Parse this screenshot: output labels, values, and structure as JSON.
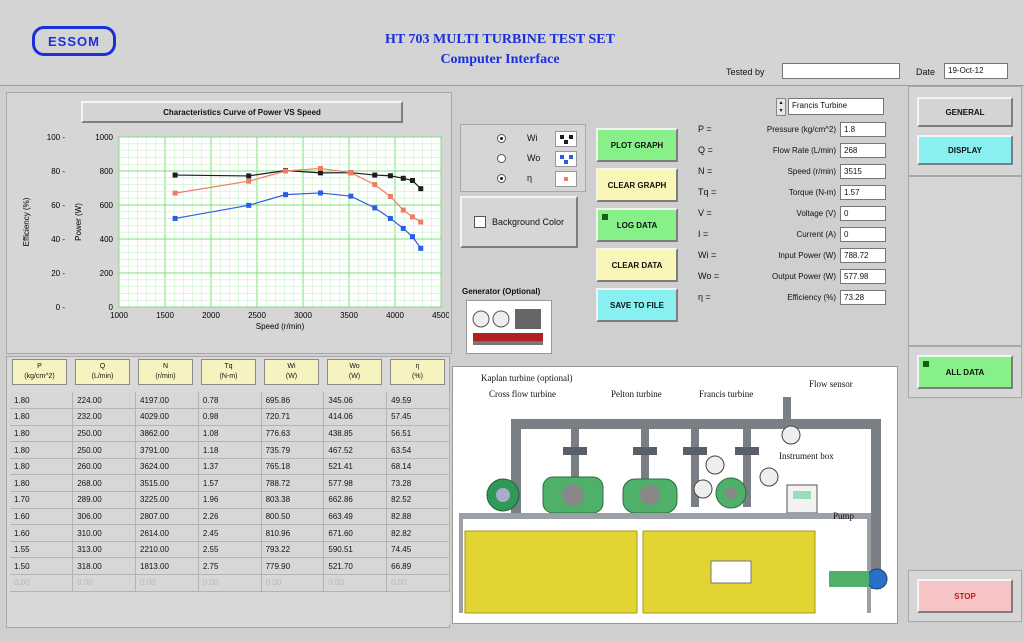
{
  "header": {
    "logo_text": "ESSOM",
    "title": "HT 703 MULTI TURBINE TEST SET",
    "subtitle": "Computer Interface",
    "tested_by_label": "Tested by",
    "tested_by_value": "",
    "date_label": "Date",
    "date_value": "19-Oct-12"
  },
  "graph": {
    "panel_title": "Characteristics Curve of Power VS Speed",
    "legend": [
      {
        "symbol": "Wi",
        "selected": true,
        "color": "#1d1d1d"
      },
      {
        "symbol": "Wo",
        "selected": false,
        "color": "#2b5ce6"
      },
      {
        "symbol": "η",
        "selected": true,
        "color": "#f07c66"
      }
    ],
    "background_color_label": "Background Color"
  },
  "chart_data": {
    "type": "line",
    "xlabel": "Speed (r/min)",
    "ylabel": "Power (W)",
    "ylabel2": "Efficiency (%)",
    "xlim": [
      1000,
      4500
    ],
    "ylim": [
      0,
      1000
    ],
    "ylim2": [
      0,
      100
    ],
    "x_ticks": [
      1000,
      1500,
      2000,
      2500,
      3000,
      3500,
      4000,
      4500
    ],
    "y_ticks": [
      0,
      200,
      400,
      600,
      800,
      1000
    ],
    "y2_ticks": [
      0,
      20,
      40,
      60,
      80,
      100
    ],
    "series": [
      {
        "name": "Wi",
        "color": "#1d1d1d",
        "marker": "square",
        "x": [
          1610,
          2410,
          2810,
          3190,
          3520,
          3780,
          3950,
          4090,
          4190,
          4280
        ],
        "y": [
          776,
          771,
          803,
          789,
          790,
          776,
          772,
          757,
          744,
          696
        ]
      },
      {
        "name": "η",
        "color": "#f07c66",
        "marker": "square",
        "x": [
          1610,
          2410,
          2810,
          3190,
          3520,
          3780,
          3950,
          4090,
          4190,
          4280
        ],
        "y": [
          670,
          740,
          800,
          815,
          790,
          720,
          650,
          570,
          530,
          500
        ]
      },
      {
        "name": "Wo",
        "color": "#2b5ce6",
        "marker": "square",
        "x": [
          1610,
          2410,
          2810,
          3190,
          3520,
          3780,
          3950,
          4090,
          4190,
          4280
        ],
        "y": [
          521,
          598,
          661,
          671,
          652,
          583,
          521,
          462,
          414,
          345
        ]
      }
    ]
  },
  "buttons": {
    "plot_graph": "PLOT GRAPH",
    "clear_graph": "CLEAR GRAPH",
    "log_data": "LOG DATA",
    "clear_data": "CLEAR DATA",
    "save_to_file": "SAVE TO FILE",
    "general": "GENERAL",
    "display": "DISPLAY",
    "all_data": "ALL DATA",
    "stop": "STOP"
  },
  "turbine_select": "Francis Turbine",
  "params": [
    {
      "sym": "P =",
      "label": "Pressure (kg/cm^2)",
      "value": "1.8"
    },
    {
      "sym": "Q =",
      "label": "Flow Rate (L/min)",
      "value": "268"
    },
    {
      "sym": "N =",
      "label": "Speed (r/min)",
      "value": "3515"
    },
    {
      "sym": "Tq =",
      "label": "Torque (N-m)",
      "value": "1.57"
    },
    {
      "sym": "V =",
      "label": "Voltage (V)",
      "value": "0"
    },
    {
      "sym": "I =",
      "label": "Current (A)",
      "value": "0"
    },
    {
      "sym": "Wi =",
      "label": "Input Power (W)",
      "value": "788.72"
    },
    {
      "sym": "Wo =",
      "label": "Output Power (W)",
      "value": "577.98"
    },
    {
      "sym": "η =",
      "label": "Efficiency (%)",
      "value": "73.28"
    }
  ],
  "generator_label": "Generator (Optional)",
  "table": {
    "headers": [
      [
        "P",
        "(kg/cm^2)"
      ],
      [
        "Q",
        "(L/min)"
      ],
      [
        "N",
        "(r/min)"
      ],
      [
        "Tq",
        "(N-m)"
      ],
      [
        "Wi",
        "(W)"
      ],
      [
        "Wo",
        "(W)"
      ],
      [
        "η",
        "(%)"
      ]
    ],
    "rows": [
      [
        "1.80",
        "224.00",
        "4197.00",
        "0.78",
        "695.86",
        "345.06",
        "49.59"
      ],
      [
        "1.80",
        "232.00",
        "4029.00",
        "0.98",
        "720.71",
        "414.06",
        "57.45"
      ],
      [
        "1.80",
        "250.00",
        "3862.00",
        "1.08",
        "776.63",
        "438.85",
        "56.51"
      ],
      [
        "1.80",
        "250.00",
        "3791.00",
        "1.18",
        "735.79",
        "467.52",
        "63.54"
      ],
      [
        "1.80",
        "260.00",
        "3624.00",
        "1.37",
        "765.18",
        "521.41",
        "68.14"
      ],
      [
        "1.80",
        "268.00",
        "3515.00",
        "1.57",
        "788.72",
        "577.98",
        "73.28"
      ],
      [
        "1.70",
        "289.00",
        "3225.00",
        "1.96",
        "803.38",
        "662.86",
        "82.52"
      ],
      [
        "1.60",
        "306.00",
        "2807.00",
        "2.26",
        "800.50",
        "663.49",
        "82.88"
      ],
      [
        "1.60",
        "310.00",
        "2614.00",
        "2.45",
        "810.96",
        "671.60",
        "82.82"
      ],
      [
        "1.55",
        "313.00",
        "2210.00",
        "2.55",
        "793.22",
        "590.51",
        "74.45"
      ],
      [
        "1.50",
        "318.00",
        "1813.00",
        "2.75",
        "779.90",
        "521.70",
        "66.89"
      ],
      [
        "0.00",
        "0.00",
        "0.00",
        "0.00",
        "0.00",
        "0.00",
        "0.00"
      ]
    ]
  },
  "diagram": {
    "kaplan": "Kaplan turbine (optional)",
    "crossflow": "Cross flow turbine",
    "pelton": "Pelton turbine",
    "francis": "Francis turbine",
    "flow_sensor": "Flow sensor",
    "instrument_box": "Instrument box",
    "pump": "Pump"
  }
}
